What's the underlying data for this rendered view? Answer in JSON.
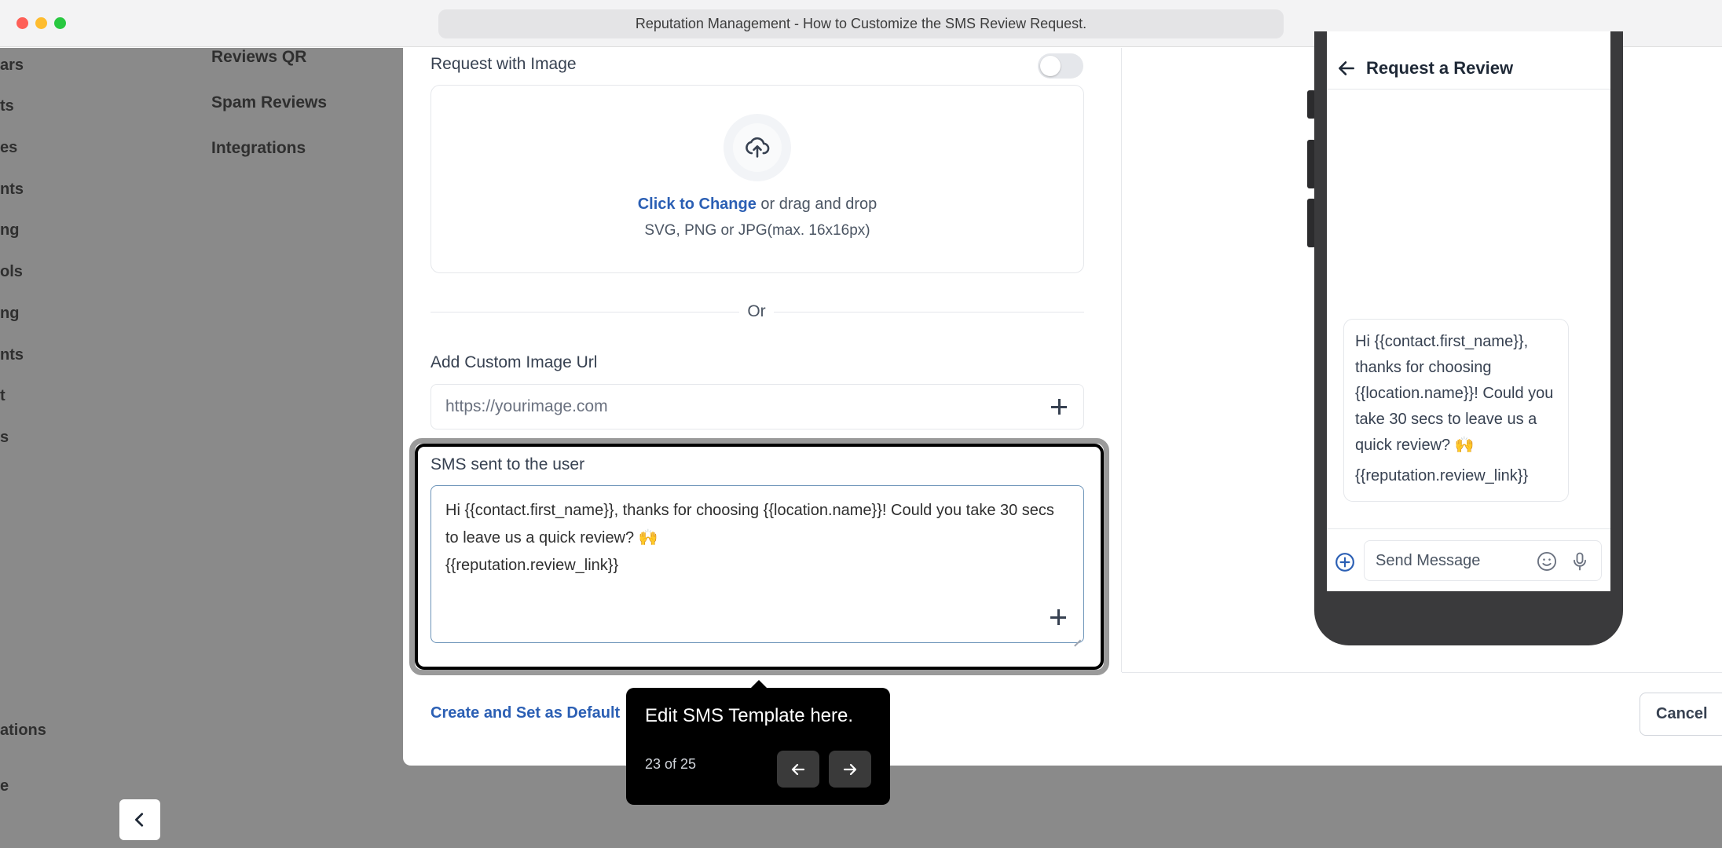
{
  "window": {
    "url_title": "Reputation Management - How to Customize the SMS Review Request."
  },
  "sidebar": {
    "items": [
      "ars",
      "ts",
      "es",
      "nts",
      "ng",
      "ols",
      "ng",
      "nts",
      "t",
      "s"
    ],
    "bottom_item": "ations",
    "bottom_item2": "e"
  },
  "subnav": {
    "items": [
      "Reviews QR",
      "Spam Reviews",
      "Integrations"
    ]
  },
  "form": {
    "request_with_image_label": "Request with Image",
    "upload": {
      "link_text": "Click to Change",
      "rest_text": " or drag and drop",
      "hint": "SVG, PNG or JPG(max. 16x16px)"
    },
    "or_text": "Or",
    "custom_url_label": "Add Custom Image Url",
    "custom_url_placeholder": "https://yourimage.com",
    "sms_label": "SMS sent to the user",
    "sms_text": "Hi {{contact.first_name}}, thanks for choosing {{location.name}}! Could you take 30 secs to leave us a quick review? 🙌\n{{reputation.review_link}}"
  },
  "footer": {
    "create_default_label": "Create and Set as Default",
    "cancel_label": "Cancel"
  },
  "phone_preview": {
    "title": "Request a Review",
    "message": "Hi {{contact.first_name}}, thanks for choosing {{location.name}}! Could you take 30 secs to leave us a quick review? 🙌",
    "review_link": "{{reputation.review_link}}",
    "composer_placeholder": "Send Message"
  },
  "tour": {
    "title": "Edit SMS Template here.",
    "step": "23 of 25"
  },
  "colors": {
    "link_blue": "#2b5fb4",
    "overlay_gray": "#8a8a8a",
    "tooltip_bg": "#000000"
  }
}
